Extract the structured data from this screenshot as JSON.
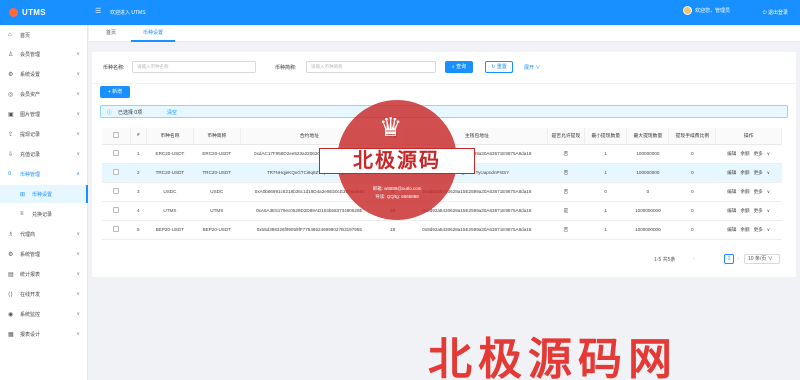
{
  "app": {
    "name": "UTMS",
    "welcome": "欢迎进入 UTMS"
  },
  "header": {
    "user_greeting": "欢迎您，管理员",
    "logout": "退出登录"
  },
  "sidebar": {
    "items": [
      {
        "label": "首页",
        "icon": "home-icon"
      },
      {
        "label": "会员管理",
        "icon": "user-icon"
      },
      {
        "label": "系统设置",
        "icon": "gear-icon"
      },
      {
        "label": "会员资产",
        "icon": "coin-icon"
      },
      {
        "label": "图片管理",
        "icon": "image-icon"
      },
      {
        "label": "提现记录",
        "icon": "withdraw-icon"
      },
      {
        "label": "充值记录",
        "icon": "deposit-icon"
      },
      {
        "label": "币种管理",
        "icon": "currency-icon"
      },
      {
        "label": "币种设置",
        "icon": "setting-icon"
      },
      {
        "label": "兑换记录",
        "icon": "exchange-icon"
      },
      {
        "label": "代理商",
        "icon": "agent-icon"
      },
      {
        "label": "系统管理",
        "icon": "system-icon"
      },
      {
        "label": "统计报表",
        "icon": "chart-icon"
      },
      {
        "label": "在线开发",
        "icon": "code-icon"
      },
      {
        "label": "系统监控",
        "icon": "monitor-icon"
      },
      {
        "label": "报表设计",
        "icon": "report-icon"
      }
    ]
  },
  "tabs": [
    {
      "label": "首页"
    },
    {
      "label": "币种设置"
    }
  ],
  "search": {
    "name_label": "币种名称:",
    "name_placeholder": "请输入币种名称",
    "alias_label": "币种简称:",
    "alias_placeholder": "请输入币种简称",
    "query_button": "查询",
    "reset_button": "重置",
    "expand_link": "展开"
  },
  "toolbar": {
    "add_button": "新增"
  },
  "selection": {
    "text": "已选择 0项",
    "clear": "清空"
  },
  "table": {
    "columns": [
      "#",
      "币种名称",
      "币种简称",
      "合约地址",
      "精度",
      "主钱包地址",
      "是否允许提现",
      "最小提现数量",
      "最大提现数量",
      "提现手续费比例",
      "操作"
    ],
    "rows": [
      {
        "no": "1",
        "name": "ERC20-USDT",
        "alias": "ERC20-USDT",
        "contract": "0xdAC17F958D2ee523a2206206994597C13D831ec7",
        "precision": "6",
        "wallet": "0x9d92a8430628a15E2599a30A63671E9875A8da18",
        "allow": "否",
        "min": "1",
        "max": "100000000",
        "fee": "0"
      },
      {
        "no": "2",
        "name": "TRC20-USDT",
        "alias": "TRC20-USDT",
        "contract": "TR7NHqjeKQxGTCi8q8ZY4pL8otSzgjLj6t",
        "precision": "6",
        "wallet": "TMBs9Kgae4CTyUapndnPstSY",
        "allow": "否",
        "min": "1",
        "max": "100000000",
        "fee": "0"
      },
      {
        "no": "3",
        "name": "USDC",
        "alias": "USDC",
        "contract": "0xA0b86991c6218b36c1d19D4a2e9Eb0cE3606eB48",
        "precision": "6",
        "wallet": "0x9d92a8430628a15E2599a30A63671E9875A8da18",
        "allow": "否",
        "min": "0",
        "max": "0",
        "fee": "0"
      },
      {
        "no": "4",
        "name": "UTMS",
        "alias": "UTMS",
        "contract": "0xA5A3E5179ec0528D2D89AD103b58373490528E",
        "precision": "18",
        "wallet": "0x9d92a8430628a15E2599a30A63671E9875A8da18",
        "allow": "是",
        "min": "1",
        "max": "1000000000",
        "fee": "0"
      },
      {
        "no": "5",
        "name": "BEP20-USDT",
        "alias": "BEP20-USDT",
        "contract": "0x55d398326f99059fF775485246999027B3197955",
        "precision": "18",
        "wallet": "0x9d92a8430628a15E2599a30A63671E9875A8da18",
        "allow": "否",
        "min": "1",
        "max": "1000000000",
        "fee": "0"
      }
    ],
    "op_edit": "编辑",
    "op_delete": "余额",
    "op_more": "更多"
  },
  "pagination": {
    "total": "1-5 共5条",
    "current": "1",
    "page_size": "10 条/页"
  },
  "watermark": {
    "seal_title": "北极源码",
    "seal_line1": "邮箱: w8888@outlo.com",
    "seal_line2": "导读: QQ/tg: 6666888",
    "big_text": "北极源码网"
  },
  "colors": {
    "primary": "#1890ff",
    "seal_red": "#c62828",
    "watermark_red": "#e53935"
  }
}
